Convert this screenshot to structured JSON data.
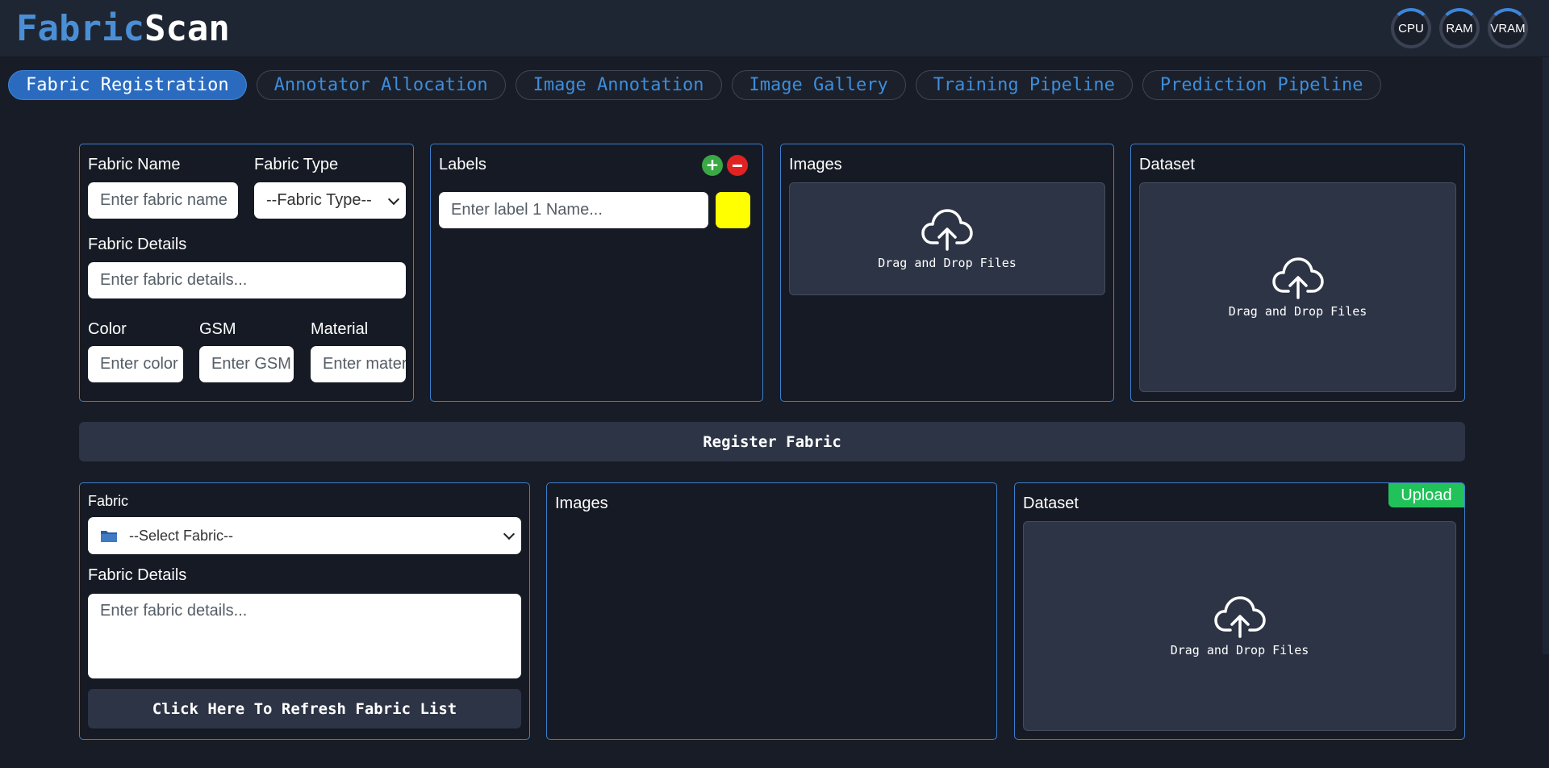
{
  "app": {
    "logo_part1": "Fabric",
    "logo_part2": "Scan",
    "gauges": [
      "CPU",
      "RAM",
      "VRAM"
    ]
  },
  "tabs": [
    {
      "label": "Fabric Registration",
      "active": true
    },
    {
      "label": "Annotator Allocation",
      "active": false
    },
    {
      "label": "Image Annotation",
      "active": false
    },
    {
      "label": "Image Gallery",
      "active": false
    },
    {
      "label": "Training Pipeline",
      "active": false
    },
    {
      "label": "Prediction Pipeline",
      "active": false
    }
  ],
  "registration": {
    "fabric_name_label": "Fabric Name",
    "fabric_name_placeholder": "Enter fabric name",
    "fabric_type_label": "Fabric Type",
    "fabric_type_selected": "--Fabric Type--",
    "fabric_details_label": "Fabric Details",
    "fabric_details_placeholder": "Enter fabric details...",
    "color_label": "Color",
    "color_placeholder": "Enter color",
    "gsm_label": "GSM",
    "gsm_placeholder": "Enter GSM",
    "material_label": "Material",
    "material_placeholder": "Enter material",
    "labels_title": "Labels",
    "label_placeholder": "Enter label 1 Name...",
    "label_color": "#ffff00",
    "images_title": "Images",
    "dataset_title": "Dataset",
    "drop_text": "Drag and Drop Files",
    "register_button": "Register Fabric"
  },
  "upload": {
    "fabric_label": "Fabric",
    "fabric_selected": "--Select Fabric--",
    "fabric_details_label": "Fabric Details",
    "fabric_details_placeholder": "Enter fabric details...",
    "refresh_button": "Click Here To Refresh Fabric List",
    "images_title": "Images",
    "dataset_title": "Dataset",
    "upload_button": "Upload",
    "drop_text": "Drag and Drop Files"
  },
  "colors": {
    "accent": "#3d86d8",
    "add": "#3aa845",
    "remove": "#e02222",
    "upload": "#22c25a"
  }
}
